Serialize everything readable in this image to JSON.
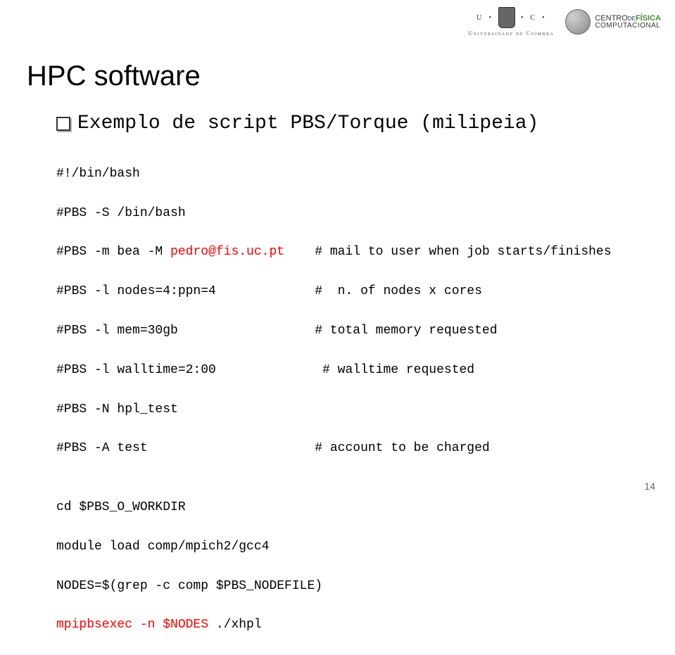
{
  "header": {
    "uc_letters_left": "U",
    "uc_letters_right": "C",
    "uc_sub": "Universidade de Coimbra",
    "cfc_l1_pre": "CENTRO",
    "cfc_l1_mid": "DE",
    "cfc_l1_post": "FÍSICA",
    "cfc_l2": "COMPUTACIONAL"
  },
  "title": "HPC software",
  "bullet": "Exemplo de script PBS/Torque (milipeia)",
  "code": {
    "l1": "#!/bin/bash",
    "l2": "#PBS -S /bin/bash",
    "l3a": "#PBS -m bea -M ",
    "l3b": "pedro@fis.uc.pt",
    "l3c": "    # mail to user when job starts/finishes",
    "l4": "#PBS -l nodes=4:ppn=4             #  n. of nodes x cores",
    "l5": "#PBS -l mem=30gb                  # total memory requested",
    "l6": "#PBS -l walltime=2:00              # walltime requested",
    "l7": "#PBS -N hpl_test",
    "l8": "#PBS -A test                      # account to be charged",
    "l9": "",
    "l10": "cd $PBS_O_WORKDIR",
    "l11": "module load comp/mpich2/gcc4",
    "l12": "NODES=$(grep -c comp $PBS_NODEFILE)",
    "l13a": "mpipbsexec -n $NODES ",
    "l13b": "./xhpl"
  },
  "page_number": "14"
}
